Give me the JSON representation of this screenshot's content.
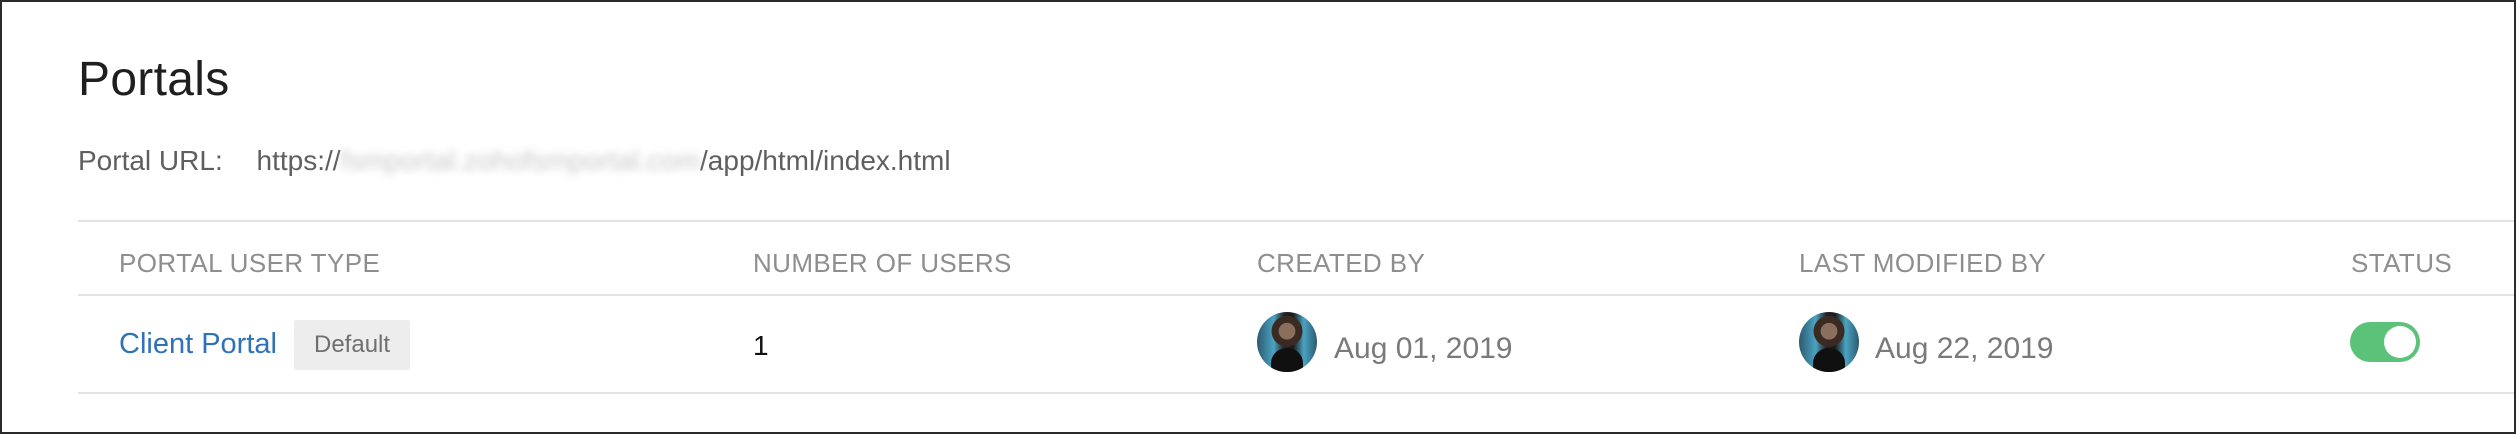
{
  "page": {
    "title": "Portals"
  },
  "portal_url": {
    "label": "Portal URL:",
    "prefix": "https://",
    "host": "fsmportal.zohofsmportal.com",
    "path": "/app/html/index.html"
  },
  "table": {
    "columns": [
      "PORTAL USER TYPE",
      "NUMBER OF USERS",
      "CREATED BY",
      "LAST MODIFIED BY",
      "STATUS"
    ],
    "rows": [
      {
        "portal_user_type": "Client Portal",
        "badge": "Default",
        "number_of_users": "1",
        "created_by_date": "Aug 01, 2019",
        "last_modified_by_date": "Aug 22, 2019",
        "status_enabled": true
      }
    ]
  },
  "colors": {
    "link": "#2f72b8",
    "toggle_on": "#5cc27a",
    "header_text": "#8e8e8e"
  },
  "icons": {
    "status_toggle": "toggle-on-icon",
    "avatar": "user-avatar"
  }
}
